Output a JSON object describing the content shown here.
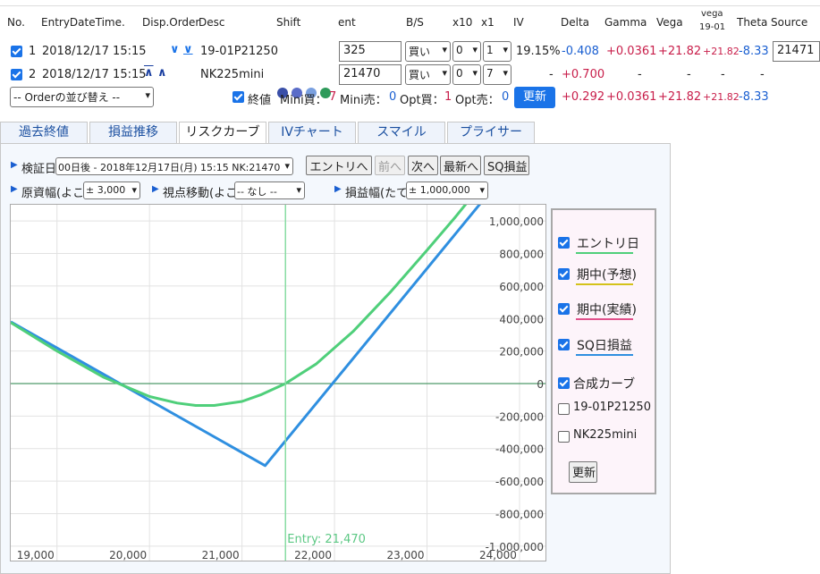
{
  "headers": {
    "no": "No.",
    "entry_dt": "EntryDateTime.",
    "disp_order": "Disp.Order",
    "desc": "Desc",
    "shift": "Shift",
    "ent": "ent",
    "bs": "B/S",
    "x10": "x10",
    "x1": "x1",
    "iv": "IV",
    "delta": "Delta",
    "gamma": "Gamma",
    "vega": "Vega",
    "vega2_a": "vega",
    "vega2_b": "19-01",
    "theta": "Theta",
    "source": "Source"
  },
  "rows": [
    {
      "no": "1",
      "dt": "2018/12/17 15:15",
      "desc": "19-01P21250",
      "ent": "325",
      "bs": "買い",
      "x10": "0",
      "x1": "1",
      "iv": "19.15%",
      "delta": "-0.408",
      "gamma": "+0.0361",
      "vega": "+21.82",
      "vega2": "+21.82",
      "theta": "-8.33",
      "source": "21471"
    },
    {
      "no": "2",
      "dt": "2018/12/17 15:15",
      "desc": "NK225mini",
      "ent": "21470",
      "bs": "買い",
      "x10": "0",
      "x1": "7",
      "iv": "-",
      "delta": "+0.700",
      "gamma": "-",
      "vega": "-",
      "vega2": "-",
      "theta": "-",
      "source": ""
    }
  ],
  "summary": {
    "order_sort": "-- Orderの並び替え --",
    "close_label": "終値",
    "mini_buy_label": "Mini買：",
    "mini_buy": "7",
    "mini_sell_label": "Mini売：",
    "mini_sell": "0",
    "opt_buy_label": "Opt買：",
    "opt_buy": "1",
    "opt_sell_label": "Opt売：",
    "opt_sell": "0",
    "update": "更新",
    "delta": "+0.292",
    "gamma": "+0.0361",
    "vega": "+21.82",
    "vega2": "+21.82",
    "theta": "-8.33"
  },
  "tabs": [
    "過去終値",
    "損益推移",
    "リスクカーブ",
    "IVチャート",
    "スマイル",
    "プライサー"
  ],
  "active_tab": 2,
  "controls": {
    "verify_label": "検証日",
    "verify_value": "00日後 - 2018年12月17日(月) 15:15 NK:21470",
    "entry_btn": "エントリへ",
    "prev_btn": "前へ",
    "next_btn": "次へ",
    "latest_btn": "最新へ",
    "sq_btn": "SQ損益",
    "underlying_label": "原資幅(よこ)",
    "underlying_value": "± 3,000",
    "view_label": "視点移動(よこ)",
    "view_value": "-- なし --",
    "pl_label": "損益幅(たて)",
    "pl_value": "± 1,000,000"
  },
  "legend": [
    {
      "label": "エントリ日",
      "checked": true,
      "color": "#4fcf7a"
    },
    {
      "label": "期中(予想)",
      "checked": true,
      "color": "#d4c21a"
    },
    {
      "label": "期中(実績)",
      "checked": true,
      "color": "#e0508a"
    },
    {
      "label": "SQ日損益",
      "checked": true,
      "color": "#2f8fe0"
    },
    {
      "label": "合成カーブ",
      "checked": true,
      "color": ""
    },
    {
      "label": "19-01P21250",
      "checked": false,
      "color": ""
    },
    {
      "label": "NK225mini",
      "checked": false,
      "color": ""
    }
  ],
  "legend_update": "更新",
  "chart_data": {
    "type": "line",
    "xlim": [
      18500,
      24300
    ],
    "ylim": [
      -1100000,
      1100000
    ],
    "x_ticks": [
      19000,
      20000,
      21000,
      22000,
      23000,
      24000
    ],
    "x_tick_labels": [
      "19,000",
      "20,000",
      "21,000",
      "22,000",
      "23,000",
      "24,000"
    ],
    "y_ticks": [
      1000000,
      800000,
      600000,
      400000,
      200000,
      0,
      -200000,
      -400000,
      -600000,
      -800000,
      -1000000
    ],
    "y_tick_labels": [
      "1,000,000",
      "800,000",
      "600,000",
      "400,000",
      "200,000",
      "0",
      "-200,000",
      "-400,000",
      "-600,000",
      "-800,000",
      "-1,000,000"
    ],
    "entry_x": 21470,
    "entry_label": "Entry: 21,470",
    "series": [
      {
        "color": "#2f8fe0",
        "points": [
          [
            18500,
            380000
          ],
          [
            21250,
            -505000
          ],
          [
            23710,
            1200000
          ]
        ]
      },
      {
        "color": "#4fcf7a",
        "points": [
          [
            18500,
            375000
          ],
          [
            19000,
            200000
          ],
          [
            19500,
            40000
          ],
          [
            20000,
            -80000
          ],
          [
            20300,
            -120000
          ],
          [
            20500,
            -135000
          ],
          [
            20700,
            -135000
          ],
          [
            21000,
            -110000
          ],
          [
            21200,
            -70000
          ],
          [
            21470,
            0
          ],
          [
            21800,
            120000
          ],
          [
            22200,
            320000
          ],
          [
            22600,
            560000
          ],
          [
            23000,
            820000
          ],
          [
            23300,
            1020000
          ],
          [
            23500,
            1160000
          ]
        ]
      }
    ]
  }
}
